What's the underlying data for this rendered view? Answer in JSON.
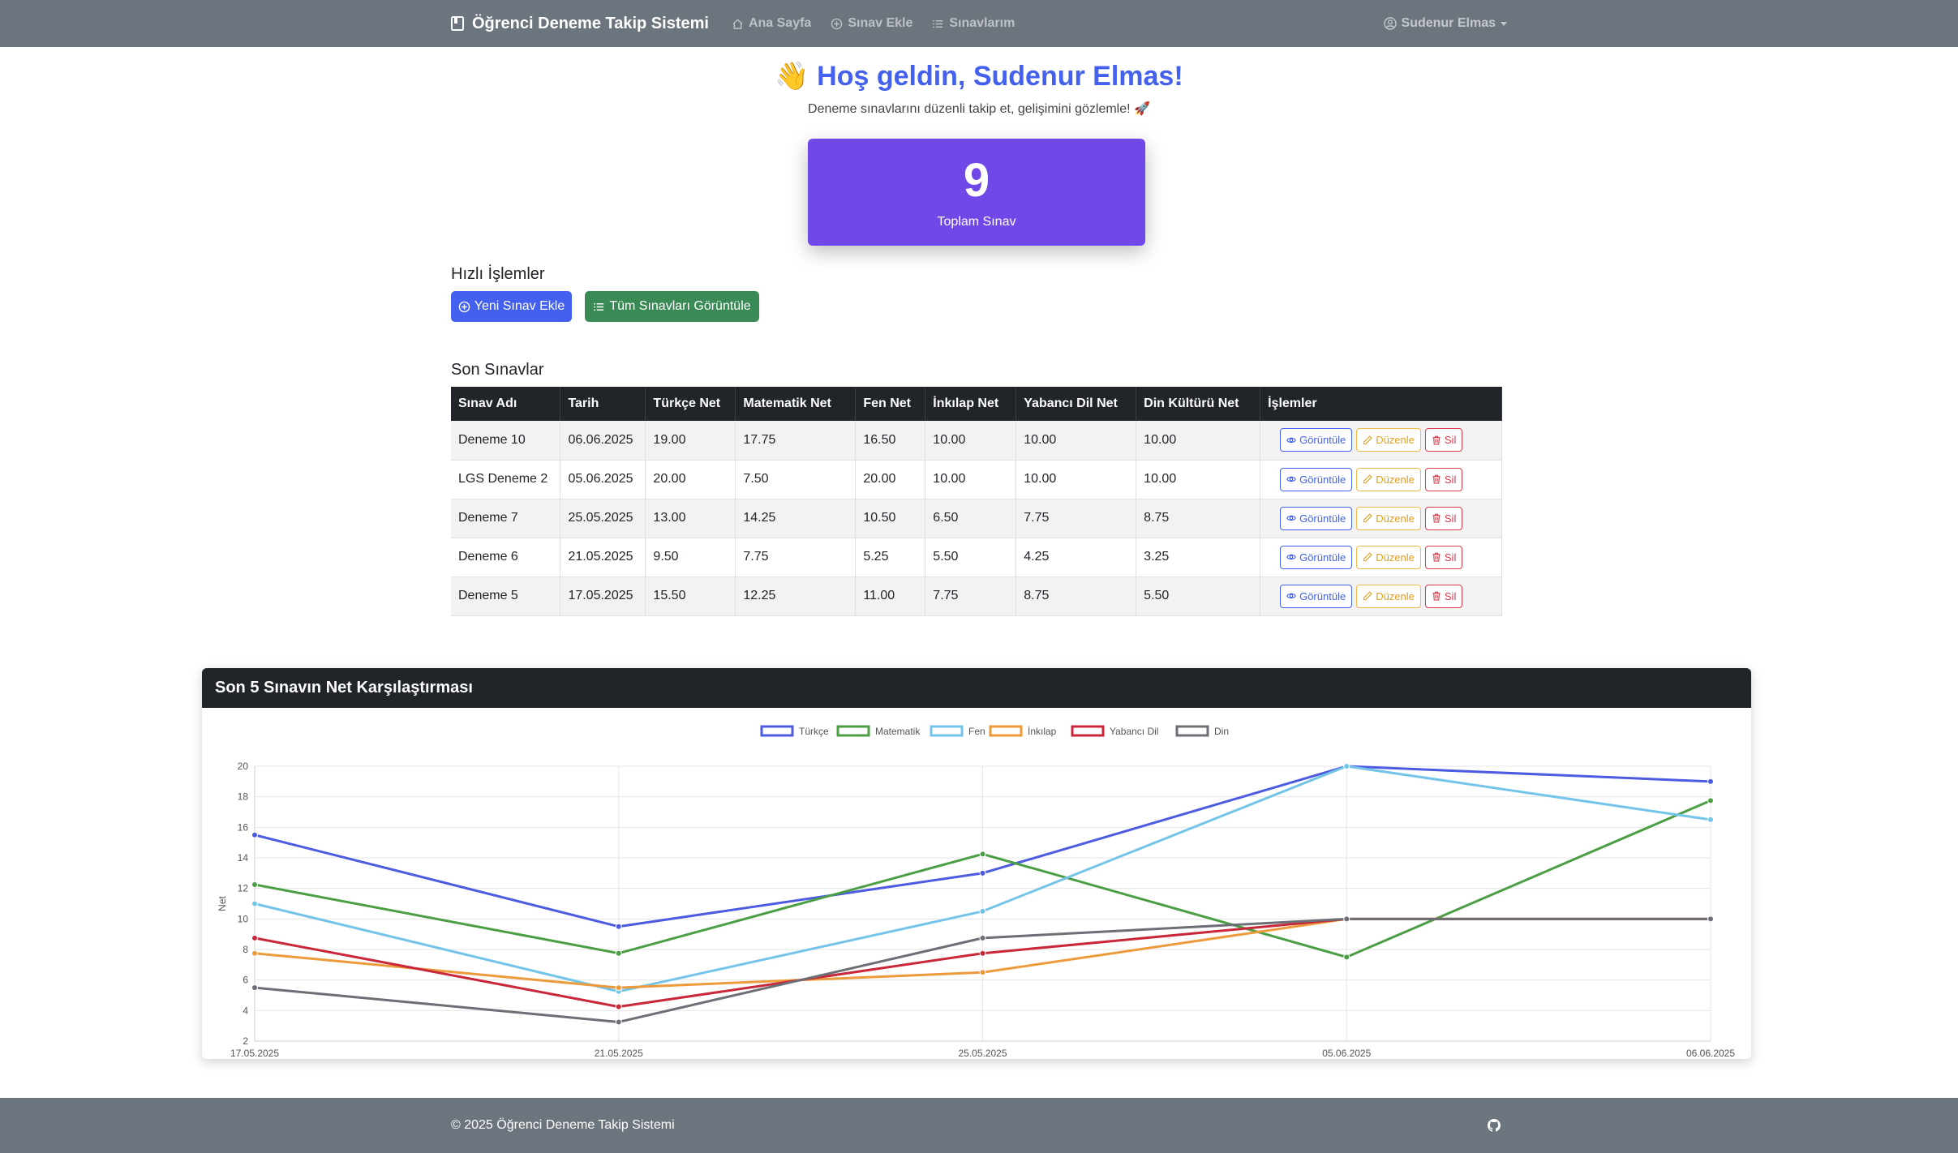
{
  "nav": {
    "brand": "Öğrenci Deneme Takip Sistemi",
    "links": [
      "Ana Sayfa",
      "Sınav Ekle",
      "Sınavlarım"
    ],
    "user": "Sudenur Elmas"
  },
  "hero": {
    "emoji": "👋",
    "title": "Hoş geldin, Sudenur Elmas!",
    "subtitle": "Deneme sınavlarını düzenli takip et, gelişimini gözlemle! 🚀"
  },
  "stats": {
    "total_value": "9",
    "total_label": "Toplam Sınav"
  },
  "quick": {
    "heading": "Hızlı İşlemler",
    "add_label": "Yeni Sınav Ekle",
    "view_all_label": "Tüm Sınavları Görüntüle"
  },
  "recent": {
    "heading": "Son Sınavlar",
    "columns": [
      "Sınav Adı",
      "Tarih",
      "Türkçe Net",
      "Matematik Net",
      "Fen Net",
      "İnkılap Net",
      "Yabancı Dil Net",
      "Din Kültürü Net",
      "İşlemler"
    ],
    "rows": [
      [
        "Deneme 10",
        "06.06.2025",
        "19.00",
        "17.75",
        "16.50",
        "10.00",
        "10.00",
        "10.00"
      ],
      [
        "LGS Deneme 2",
        "05.06.2025",
        "20.00",
        "7.50",
        "20.00",
        "10.00",
        "10.00",
        "10.00"
      ],
      [
        "Deneme 7",
        "25.05.2025",
        "13.00",
        "14.25",
        "10.50",
        "6.50",
        "7.75",
        "8.75"
      ],
      [
        "Deneme 6",
        "21.05.2025",
        "9.50",
        "7.75",
        "5.25",
        "5.50",
        "4.25",
        "3.25"
      ],
      [
        "Deneme 5",
        "17.05.2025",
        "15.50",
        "12.25",
        "11.00",
        "7.75",
        "8.75",
        "5.50"
      ]
    ],
    "actions": {
      "view": "Görüntüle",
      "edit": "Düzenle",
      "delete": "Sil"
    }
  },
  "chart_card": {
    "title": "Son 5 Sınavın Net Karşılaştırması"
  },
  "chart_data": {
    "type": "line",
    "categories": [
      "17.05.2025",
      "21.05.2025",
      "25.05.2025",
      "05.06.2025",
      "06.06.2025"
    ],
    "ylabel": "Net",
    "ylim": [
      2,
      20
    ],
    "yticks": [
      2,
      4,
      6,
      8,
      10,
      12,
      14,
      16,
      18,
      20
    ],
    "grid": true,
    "legend_position": "top",
    "series": [
      {
        "name": "Türkçe",
        "color": "#4c5be0",
        "values": [
          15.5,
          9.5,
          13.0,
          20.0,
          19.0
        ]
      },
      {
        "name": "Matematik",
        "color": "#4b9e44",
        "values": [
          12.25,
          7.75,
          14.25,
          7.5,
          17.75
        ]
      },
      {
        "name": "Fen",
        "color": "#74c3e8",
        "values": [
          11.0,
          5.25,
          10.5,
          20.0,
          16.5
        ]
      },
      {
        "name": "İnkılap",
        "color": "#eb9a3c",
        "values": [
          7.75,
          5.5,
          6.5,
          10.0,
          10.0
        ]
      },
      {
        "name": "Yabancı Dil",
        "color": "#c8283a",
        "values": [
          8.75,
          4.25,
          7.75,
          10.0,
          10.0
        ]
      },
      {
        "name": "Din",
        "color": "#6c6f75",
        "values": [
          5.5,
          3.25,
          8.75,
          10.0,
          10.0
        ]
      }
    ]
  },
  "footer": {
    "text": "© 2025 Öğrenci Deneme Takip Sistemi"
  }
}
